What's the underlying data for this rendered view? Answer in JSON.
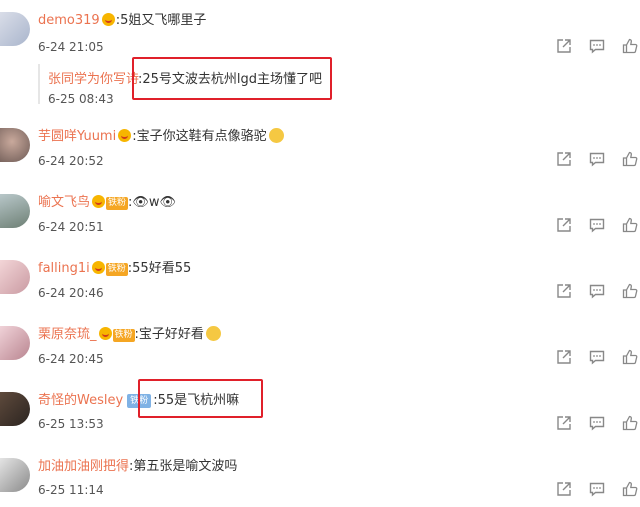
{
  "comments": [
    {
      "username": "demo319",
      "text": ":5姐又飞哪里子",
      "time": "6-24 21:05",
      "badge": "medal",
      "reply": {
        "name": "张同学为你写诗",
        "text": ":25号文波去杭州lgd主场懂了吧",
        "time": "6-25 08:43"
      }
    },
    {
      "username": "芋圆咩Yuumi",
      "text": ":宝子你这鞋有点像骆驼",
      "time": "6-24 20:52",
      "badge": "medal",
      "emoji": "happy-emoji"
    },
    {
      "username": "喻文飞鸟",
      "fan_badge": "铁粉",
      "text": ":👁w👁",
      "time": "6-24 20:51",
      "badge": "medal"
    },
    {
      "username": "falling1i",
      "fan_badge": "铁粉",
      "text": ":55好看55",
      "time": "6-24 20:46",
      "badge": "medal"
    },
    {
      "username": "栗原奈琉_",
      "fan_badge": "铁粉",
      "text": ":宝子好好看",
      "time": "6-24 20:45",
      "badge": "medal",
      "emoji": "crying-emoji"
    },
    {
      "username": "奇怪的Wesley",
      "fan_badge": "铁粉",
      "text": ":55是飞杭州嘛",
      "time": "6-25 13:53",
      "badge": "blue"
    },
    {
      "username": "加油加油刚把得",
      "text": ":第五张是喻文波吗",
      "time": "6-25 11:14",
      "badge": "none"
    }
  ],
  "actions": [
    "share-icon",
    "comment-icon",
    "like-icon"
  ],
  "colors": {
    "username": "#eb7350",
    "highlight": "#e0202a"
  }
}
